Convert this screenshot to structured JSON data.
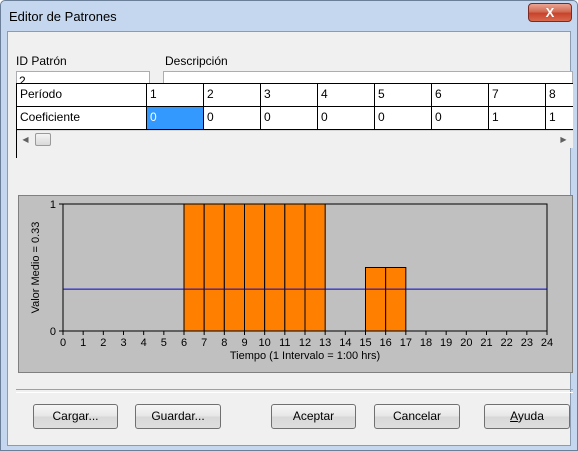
{
  "window": {
    "title": "Editor de Patrones",
    "close_glyph": "X"
  },
  "fields": {
    "id_label": "ID Patrón",
    "id_value": "2",
    "desc_label": "Descripción",
    "desc_value": ""
  },
  "grid": {
    "row_labels": [
      "Período",
      "Coeficiente"
    ],
    "periods": [
      "1",
      "2",
      "3",
      "4",
      "5",
      "6",
      "7",
      "8"
    ],
    "coefficients": [
      "0",
      "0",
      "0",
      "0",
      "0",
      "0",
      "1",
      "1"
    ],
    "selected_index": 0,
    "scroll_left_icon": "chevron-left-icon",
    "scroll_right_icon": "chevron-right-icon"
  },
  "chart_data": {
    "type": "bar",
    "title": "",
    "xlabel": "Tiempo (1 Intervalo = 1:00 hrs)",
    "ylabel": "Valor Medio = 0.33",
    "x_ticks": [
      "0",
      "1",
      "2",
      "3",
      "4",
      "5",
      "6",
      "7",
      "8",
      "9",
      "10",
      "11",
      "12",
      "13",
      "14",
      "15",
      "16",
      "17",
      "18",
      "19",
      "20",
      "21",
      "22",
      "23",
      "24"
    ],
    "y_ticks": [
      "0",
      "1"
    ],
    "xlim": [
      0,
      24
    ],
    "ylim": [
      0,
      1
    ],
    "mean": 0.33,
    "values": [
      0,
      0,
      0,
      0,
      0,
      0,
      1,
      1,
      1,
      1,
      1,
      1,
      1,
      0,
      0,
      0.5,
      0.5,
      0,
      0,
      0,
      0,
      0,
      0,
      0
    ],
    "bar_color": "#ff8000",
    "mean_line_color": "#0000cc",
    "plot_background": "#c0c0c0"
  },
  "buttons": {
    "load": "Cargar...",
    "save": "Guardar...",
    "ok": "Aceptar",
    "cancel": "Cancelar",
    "help": "Ayuda"
  }
}
